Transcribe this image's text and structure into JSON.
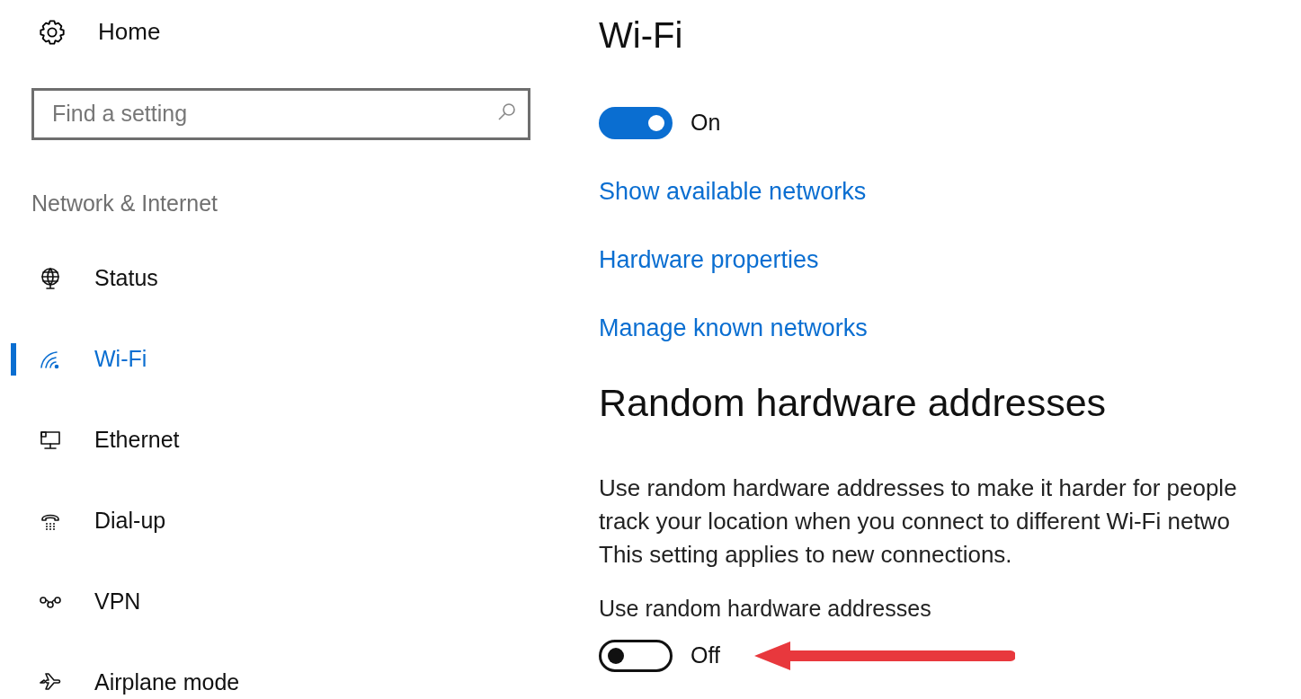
{
  "sidebar": {
    "home": {
      "label": "Home"
    },
    "search": {
      "placeholder": "Find a setting"
    },
    "section_title": "Network & Internet",
    "items": [
      {
        "label": "Status",
        "selected": false
      },
      {
        "label": "Wi-Fi",
        "selected": true
      },
      {
        "label": "Ethernet",
        "selected": false
      },
      {
        "label": "Dial-up",
        "selected": false
      },
      {
        "label": "VPN",
        "selected": false
      },
      {
        "label": "Airplane mode",
        "selected": false
      }
    ]
  },
  "main": {
    "title": "Wi-Fi",
    "wifi_toggle": {
      "on": true,
      "state_text": "On"
    },
    "links": [
      "Show available networks",
      "Hardware properties",
      "Manage known networks"
    ],
    "section_heading": "Random hardware addresses",
    "description_lines": [
      "Use random hardware addresses to make it harder for people",
      "track your location when you connect to different Wi-Fi netwo",
      "This setting applies to new connections."
    ],
    "random_toggle": {
      "label": "Use random hardware addresses",
      "on": false,
      "state_text": "Off"
    }
  }
}
